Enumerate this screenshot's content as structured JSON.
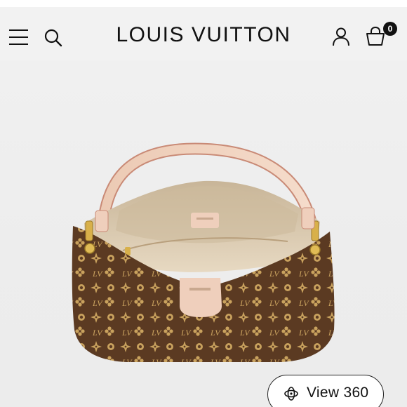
{
  "header": {
    "brand": "LOUIS VUITTON",
    "cart_count": "0",
    "icons": [
      "menu-icon",
      "search-icon",
      "account-icon",
      "shopping-bag-icon"
    ]
  },
  "product": {
    "view_360_label": "View 360",
    "view_360_icon": "rotate-360-icon"
  },
  "colors": {
    "canvas_brown": "#5b3a22",
    "monogram_gold": "#c9a25e",
    "leather_trim": "#f0d2bf",
    "lining_beige": "#d8c6a9",
    "hardware_gold": "#d8b04a"
  }
}
